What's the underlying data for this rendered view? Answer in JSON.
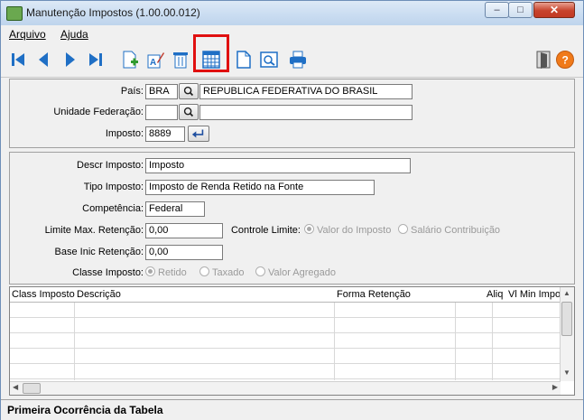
{
  "window": {
    "title": "Manutenção Impostos (1.00.00.012)"
  },
  "menu": {
    "items": [
      "Arquivo",
      "Ajuda"
    ]
  },
  "toolbar": {
    "icons": [
      "first-record-icon",
      "previous-record-icon",
      "next-record-icon",
      "last-record-icon",
      "new-record-icon",
      "edit-record-icon",
      "delete-record-icon",
      "table-icon",
      "document-icon",
      "preview-icon",
      "print-icon",
      "exit-icon",
      "help-icon"
    ]
  },
  "header_form": {
    "pais_label": "País:",
    "pais_code": "BRA",
    "pais_name": "REPUBLICA FEDERATIVA DO BRASIL",
    "uf_label": "Unidade Federação:",
    "uf_code": "",
    "uf_name": "",
    "imposto_label": "Imposto:",
    "imposto_value": "8889"
  },
  "detail_form": {
    "descr_label": "Descr Imposto:",
    "descr_value": "Imposto",
    "tipo_label": "Tipo Imposto:",
    "tipo_value": "Imposto de Renda Retido na Fonte",
    "competencia_label": "Competência:",
    "competencia_value": "Federal",
    "limite_label": "Limite Max. Retenção:",
    "limite_value": "0,00",
    "controle_label": "Controle Limite:",
    "controle_options": [
      "Valor do Imposto",
      "Salário Contribuição"
    ],
    "base_label": "Base Inic Retenção:",
    "base_value": "0,00",
    "classe_label": "Classe Imposto:",
    "classe_options": [
      "Retido",
      "Taxado",
      "Valor Agregado"
    ]
  },
  "grid": {
    "columns": [
      "Class Imposto",
      "Descrição",
      "Forma Retenção",
      "Aliq",
      "Vl Min Impos"
    ],
    "rows": 5
  },
  "status": {
    "text": "Primeira Ocorrência da Tabela"
  },
  "colors": {
    "highlight": "#e01010",
    "toolbar_icon": "#1f6fc5"
  }
}
